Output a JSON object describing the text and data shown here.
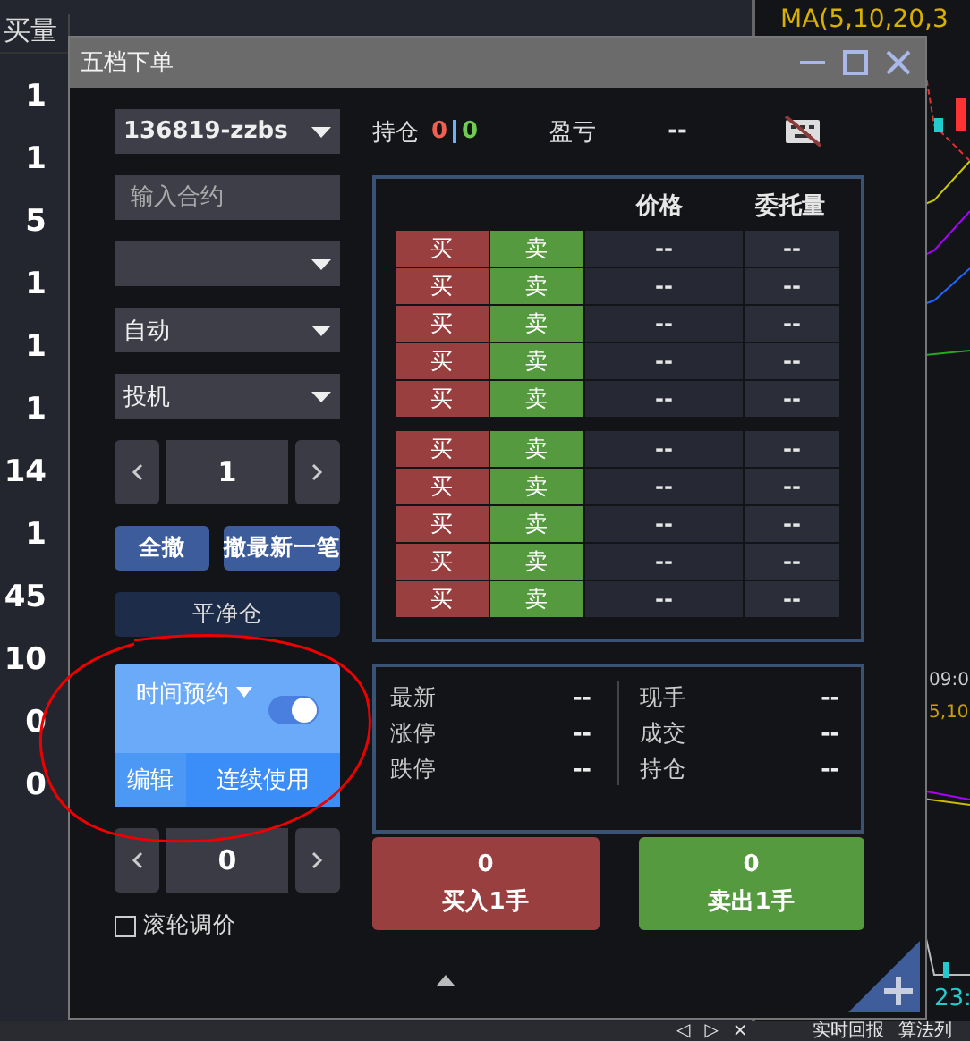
{
  "background": {
    "header": [
      "买量"
    ],
    "volume_column": [
      "1",
      "1",
      "5",
      "1",
      "1",
      "1",
      "14",
      "1",
      "45",
      "10",
      "0",
      "0"
    ],
    "chart_labels": {
      "ma": "MA(5,10,20,3",
      "time": "09:0",
      "ma_short": "5,10",
      "time_bottom": "23:"
    },
    "bottom_bar": {
      "nav": [
        "◁",
        "▷",
        "×"
      ],
      "tabs": [
        "实时回报",
        "算法列"
      ]
    }
  },
  "dialog": {
    "title": "五档下单",
    "account": "136819-zzbs",
    "contract_placeholder": "输入合约",
    "mode": "自动",
    "hedge": "投机",
    "quantity": "1",
    "cancel_buttons": [
      "全撤",
      "撤最新一笔"
    ],
    "close_position": "平净仓",
    "schedule": {
      "label": "时间预约",
      "on": true,
      "edit": "编辑",
      "repeat": "连续使用"
    },
    "price": "0",
    "wheel_adjust": {
      "label": "滚轮调价",
      "checked": false
    },
    "position": {
      "label": "持仓",
      "long": "0",
      "short": "0",
      "pnl_label": "盈亏",
      "pnl": "--"
    },
    "depth": {
      "columns": [
        "价格",
        "委托量"
      ],
      "ask_rows": [
        {
          "buy": "买",
          "sell": "卖",
          "price": "--",
          "volume": "--"
        },
        {
          "buy": "买",
          "sell": "卖",
          "price": "--",
          "volume": "--"
        },
        {
          "buy": "买",
          "sell": "卖",
          "price": "--",
          "volume": "--"
        },
        {
          "buy": "买",
          "sell": "卖",
          "price": "--",
          "volume": "--"
        },
        {
          "buy": "买",
          "sell": "卖",
          "price": "--",
          "volume": "--"
        }
      ],
      "bid_rows": [
        {
          "buy": "买",
          "sell": "卖",
          "price": "--",
          "volume": "--"
        },
        {
          "buy": "买",
          "sell": "卖",
          "price": "--",
          "volume": "--"
        },
        {
          "buy": "买",
          "sell": "卖",
          "price": "--",
          "volume": "--"
        },
        {
          "buy": "买",
          "sell": "卖",
          "price": "--",
          "volume": "--"
        },
        {
          "buy": "买",
          "sell": "卖",
          "price": "--",
          "volume": "--"
        }
      ]
    },
    "quote_left": [
      {
        "label": "最新",
        "value": "--"
      },
      {
        "label": "涨停",
        "value": "--"
      },
      {
        "label": "跌停",
        "value": "--"
      }
    ],
    "quote_right": [
      {
        "label": "现手",
        "value": "--"
      },
      {
        "label": "成交",
        "value": "--"
      },
      {
        "label": "持仓",
        "value": "--"
      }
    ],
    "buy_button": {
      "count": "0",
      "label": "买入1手"
    },
    "sell_button": {
      "count": "0",
      "label": "卖出1手"
    }
  }
}
